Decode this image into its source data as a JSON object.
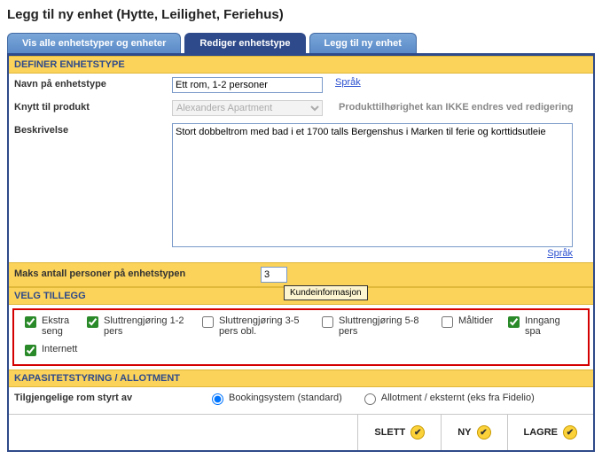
{
  "page_title": "Legg til ny enhet (Hytte, Leilighet, Feriehus)",
  "tabs": {
    "all": "Vis alle enhetstyper og enheter",
    "edit": "Rediger enhetstype",
    "add": "Legg til ny enhet"
  },
  "sections": {
    "define": "DEFINER ENHETSTYPE",
    "addons": "VELG TILLEGG",
    "capacity": "KAPASITETSTYRING / ALLOTMENT"
  },
  "labels": {
    "name": "Navn på enhetstype",
    "product": "Knytt til produkt",
    "desc": "Beskrivelse",
    "max": "Maks antall personer på enhetstypen",
    "avail": "Tilgjengelige rom styrt av"
  },
  "fields": {
    "name_value": "Ett rom, 1-2 personer",
    "product_value": "Alexanders Apartment",
    "desc_value": "Stort dobbeltrom med bad i et 1700 talls Bergenshus i Marken til ferie og korttidsutleie",
    "max_value": "3"
  },
  "links": {
    "lang": "Språk"
  },
  "note_product": "Produkttilhørighet kan IKKE endres ved redigering",
  "tooltip": "Kundeinformasjon",
  "addons": {
    "a1": "Ekstra seng",
    "a2": "Sluttrengjøring 1-2 pers",
    "a3": "Sluttrengjøring 3-5 pers obl.",
    "a4": "Sluttrengjøring 5-8 pers",
    "a5": "Måltider",
    "a6": "Inngang spa",
    "a7": "Internett"
  },
  "radios": {
    "r1": "Bookingsystem (standard)",
    "r2": "Allotment / eksternt (eks fra Fidelio)"
  },
  "buttons": {
    "delete": "SLETT",
    "new": "NY",
    "save": "LAGRE"
  }
}
